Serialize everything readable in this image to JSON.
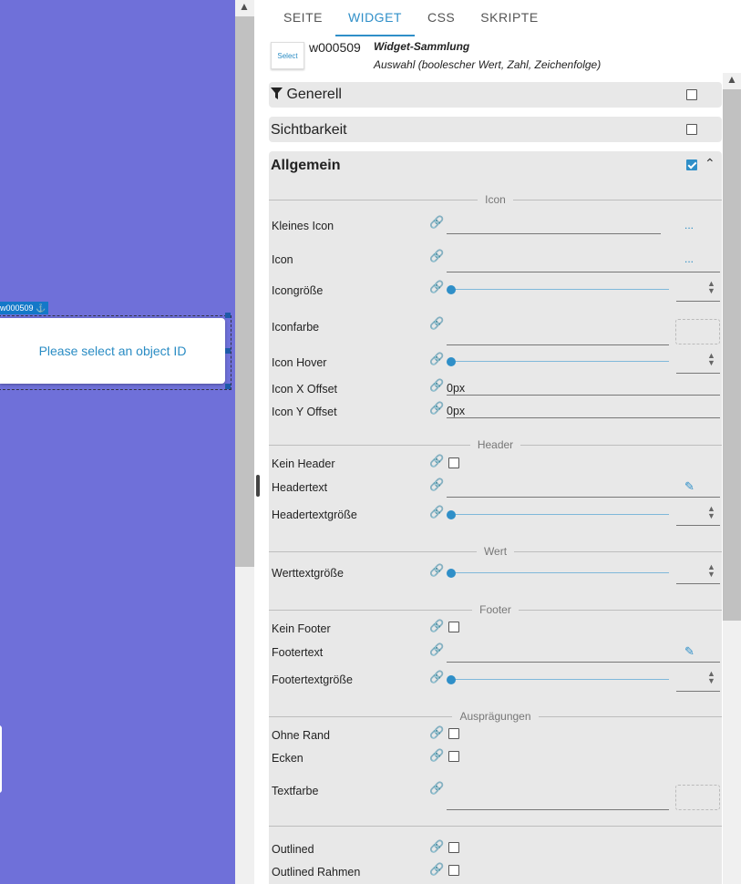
{
  "canvas": {
    "widget_id_label": "w000509",
    "widget_text": "Please select an object ID",
    "background": "#6f70d9"
  },
  "tabs": [
    {
      "label": "SEITE",
      "active": false
    },
    {
      "label": "WIDGET",
      "active": true
    },
    {
      "label": "CSS",
      "active": false
    },
    {
      "label": "SKRIPTE",
      "active": false
    }
  ],
  "widget_info": {
    "thumb_text": "Select",
    "id": "w000509",
    "set": "Widget-Sammlung",
    "description": "Auswahl (boolescher Wert, Zahl, Zeichenfolge)"
  },
  "groups": {
    "generell": {
      "title": "Generell",
      "icon": "filter-icon",
      "checked": false
    },
    "sichtbarkeit": {
      "title": "Sichtbarkeit",
      "checked": false
    },
    "allgemein": {
      "title": "Allgemein",
      "checked": true,
      "expanded": true
    }
  },
  "sections": {
    "icon": "Icon",
    "header": "Header",
    "wert": "Wert",
    "footer": "Footer",
    "auspraegungen": "Ausprägungen"
  },
  "fields": {
    "kleines_icon": {
      "label": "Kleines Icon",
      "more": "..."
    },
    "icon": {
      "label": "Icon",
      "more": "..."
    },
    "icongroesse": {
      "label": "Icongröße"
    },
    "iconfarbe": {
      "label": "Iconfarbe"
    },
    "icon_hover": {
      "label": "Icon Hover"
    },
    "icon_x_offset": {
      "label": "Icon X Offset",
      "value": "0px"
    },
    "icon_y_offset": {
      "label": "Icon Y Offset",
      "value": "0px"
    },
    "kein_header": {
      "label": "Kein Header",
      "checked": false
    },
    "headertext": {
      "label": "Headertext"
    },
    "headertextgroesse": {
      "label": "Headertextgröße"
    },
    "werttextgroesse": {
      "label": "Werttextgröße"
    },
    "kein_footer": {
      "label": "Kein Footer",
      "checked": false
    },
    "footertext": {
      "label": "Footertext"
    },
    "footertextgroesse": {
      "label": "Footertextgröße"
    },
    "ohne_rand": {
      "label": "Ohne Rand",
      "checked": false
    },
    "ecken": {
      "label": "Ecken",
      "checked": false
    },
    "textfarbe": {
      "label": "Textfarbe"
    },
    "outlined": {
      "label": "Outlined",
      "checked": false
    },
    "outlined_rahmen": {
      "label": "Outlined Rahmen",
      "checked": false
    }
  },
  "colors": {
    "accent": "#2f8fc8",
    "panel_bg": "#e8e8e8"
  }
}
